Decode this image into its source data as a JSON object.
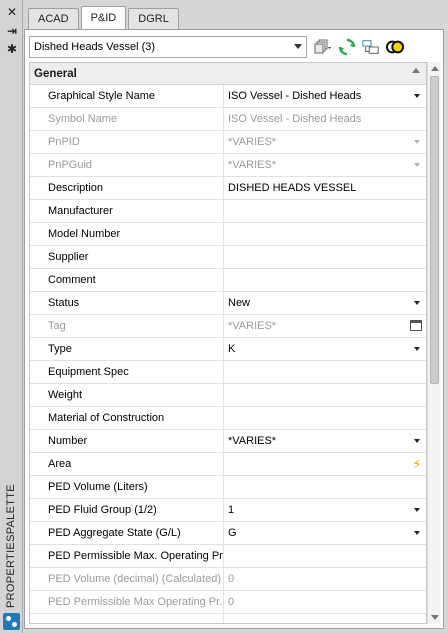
{
  "left_strip": {
    "close_glyph": "✕",
    "pin_glyph": "⇥",
    "settings_glyph": "✱",
    "title": "PROPERTIESPALETTE"
  },
  "tabs": [
    {
      "label": "ACAD",
      "active": false
    },
    {
      "label": "P&ID",
      "active": true
    },
    {
      "label": "DGRL",
      "active": false
    }
  ],
  "selector": {
    "value": "Dished Heads Vessel (3)"
  },
  "toolbar": {
    "icons": [
      "quick-select-icon",
      "refresh-icon",
      "select-objects-icon",
      "toggle-pickadd-icon"
    ],
    "colors": {
      "refresh": "#2fa84f",
      "select": "#1e7bb5"
    }
  },
  "section": {
    "title": "General"
  },
  "properties": [
    {
      "name": "Graphical Style Name",
      "value": "ISO Vessel - Dished Heads",
      "control": "dropdown",
      "disabled": false
    },
    {
      "name": "Symbol Name",
      "value": "ISO Vessel - Dished Heads",
      "control": "none",
      "disabled": true
    },
    {
      "name": "PnPID",
      "value": "*VARIES*",
      "control": "dropdown",
      "disabled": true
    },
    {
      "name": "PnPGuid",
      "value": "*VARIES*",
      "control": "dropdown",
      "disabled": true
    },
    {
      "name": "Description",
      "value": "DISHED HEADS VESSEL",
      "control": "none",
      "disabled": false
    },
    {
      "name": "Manufacturer",
      "value": "",
      "control": "none",
      "disabled": false
    },
    {
      "name": "Model Number",
      "value": "",
      "control": "none",
      "disabled": false
    },
    {
      "name": "Supplier",
      "value": "",
      "control": "none",
      "disabled": false
    },
    {
      "name": "Comment",
      "value": "",
      "control": "none",
      "disabled": false
    },
    {
      "name": "Status",
      "value": "New",
      "control": "dropdown",
      "disabled": false
    },
    {
      "name": "Tag",
      "value": "*VARIES*",
      "control": "tag-button",
      "disabled": true
    },
    {
      "name": "Type",
      "value": "K",
      "control": "dropdown",
      "disabled": false
    },
    {
      "name": "Equipment Spec",
      "value": "",
      "control": "none",
      "disabled": false
    },
    {
      "name": "Weight",
      "value": "",
      "control": "none",
      "disabled": false
    },
    {
      "name": "Material of Construction",
      "value": "",
      "control": "none",
      "disabled": false
    },
    {
      "name": "Number",
      "value": "*VARIES*",
      "control": "dropdown",
      "disabled": false
    },
    {
      "name": "Area",
      "value": "",
      "control": "bolt",
      "disabled": false
    },
    {
      "name": "PED Volume (Liters)",
      "value": "",
      "control": "none",
      "disabled": false
    },
    {
      "name": "PED Fluid Group (1/2)",
      "value": "1",
      "control": "dropdown",
      "disabled": false
    },
    {
      "name": "PED Aggregate State (G/L)",
      "value": "G",
      "control": "dropdown",
      "disabled": false
    },
    {
      "name": "PED Permissible Max. Operating Pr...",
      "value": "",
      "control": "none",
      "disabled": false
    },
    {
      "name": "PED Volume (decimal) (Calculated)",
      "value": "0",
      "control": "none",
      "disabled": true
    },
    {
      "name": "PED Permissible Max Operating Pr...",
      "value": "0",
      "control": "none",
      "disabled": true
    },
    {
      "name": "",
      "value": "",
      "control": "none",
      "disabled": true
    }
  ]
}
